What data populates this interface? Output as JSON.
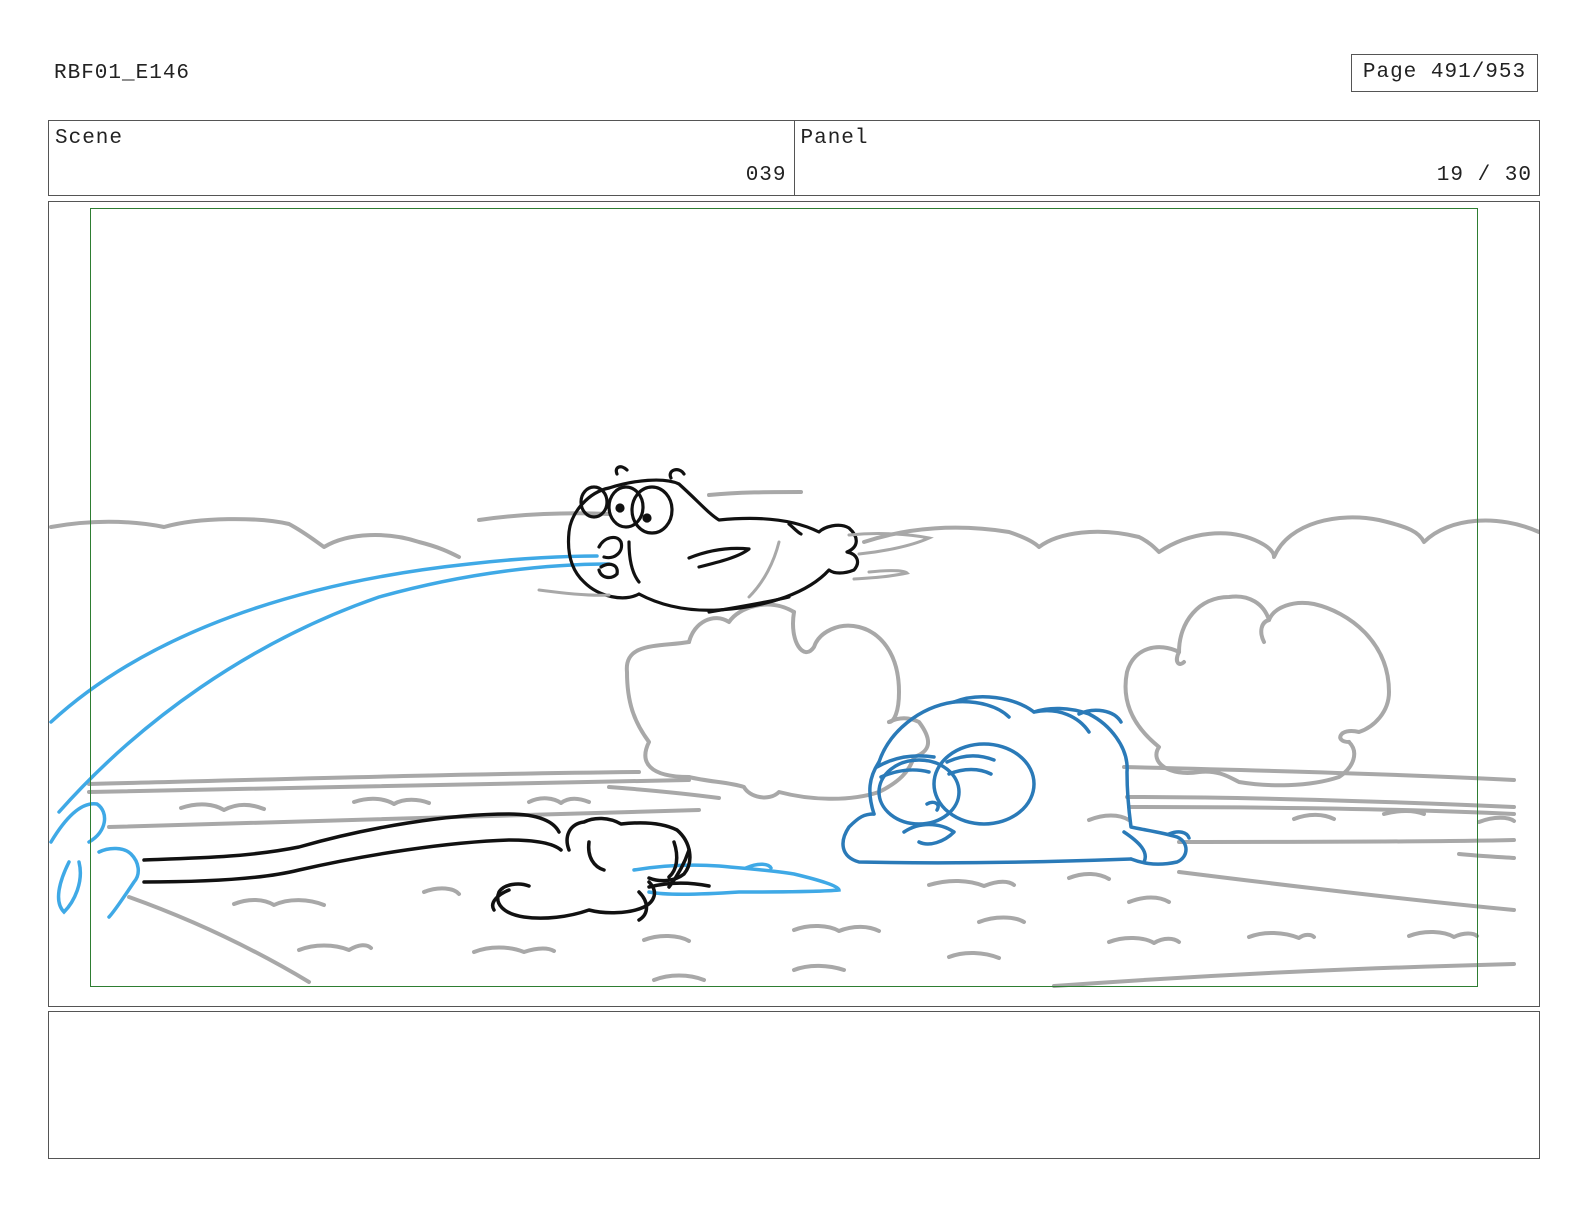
{
  "header": {
    "doc_id": "RBF01_E146",
    "page_label": "Page 491/953"
  },
  "info": {
    "scene_label": "Scene",
    "scene_value": "039",
    "panel_label": "Panel",
    "panel_value": "19 / 30"
  },
  "colors": {
    "safe_frame": "#2e7d32",
    "sketch_gray": "#a8a8a8",
    "ink_black": "#111111",
    "ink_blue_light": "#3fa9e6",
    "ink_blue_dark": "#2a7ab8"
  },
  "notes": {
    "text": ""
  }
}
